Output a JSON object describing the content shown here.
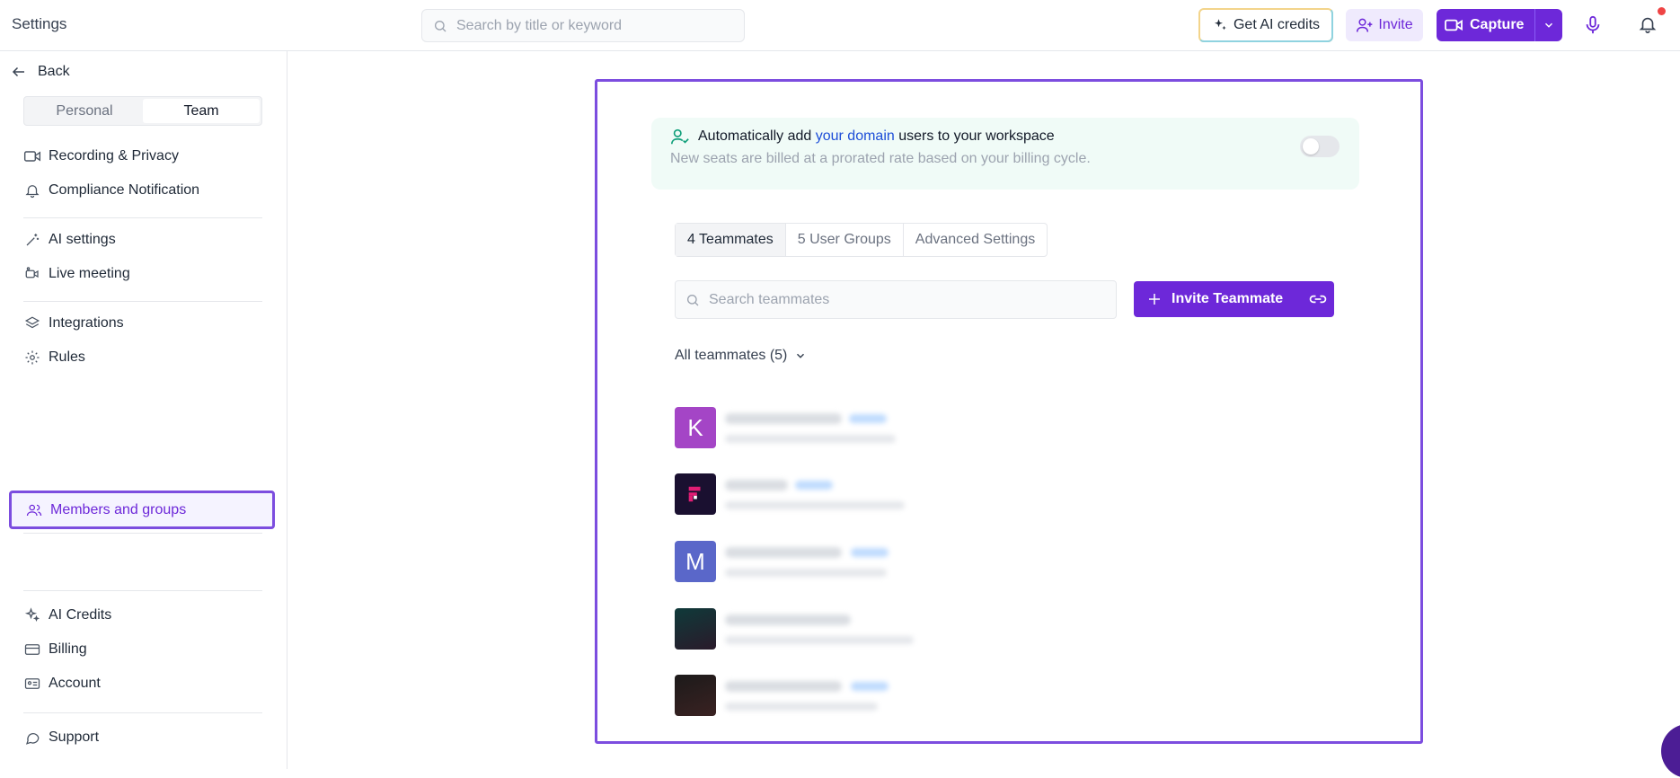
{
  "header": {
    "title": "Settings",
    "search_placeholder": "Search by title or keyword",
    "credits_label": "Get AI credits",
    "invite_label": "Invite",
    "capture_label": "Capture",
    "notification_dot_color": "#ef4444"
  },
  "sidebar": {
    "back_label": "Back",
    "segments": [
      "Personal",
      "Team"
    ],
    "active_segment": "Team",
    "items": [
      {
        "label": "Recording & Privacy",
        "icon": "video-camera-icon"
      },
      {
        "label": "Compliance Notification",
        "icon": "bell-icon"
      },
      {
        "label": "AI settings",
        "icon": "magic-wand-icon"
      },
      {
        "label": "Live meeting",
        "icon": "live-meeting-icon"
      },
      {
        "label": "Integrations",
        "icon": "layers-icon"
      },
      {
        "label": "Rules",
        "icon": "gear-icon"
      },
      {
        "label": "Members and groups",
        "icon": "users-icon"
      },
      {
        "label": "AI Credits",
        "icon": "sparkles-icon"
      },
      {
        "label": "Billing",
        "icon": "credit-card-icon"
      },
      {
        "label": "Account",
        "icon": "id-card-icon"
      },
      {
        "label": "Support",
        "icon": "chat-icon"
      }
    ],
    "active_item": "Members and groups"
  },
  "main": {
    "banner": {
      "text_before": "Automatically add ",
      "link_text": "your domain",
      "text_after": " users to your workspace",
      "subtext": "New seats are billed at a prorated rate based on your billing cycle.",
      "toggle_on": false
    },
    "tabs": [
      {
        "label": "4 Teammates",
        "active": true
      },
      {
        "label": "5 User Groups",
        "active": false
      },
      {
        "label": "Advanced Settings",
        "active": false
      }
    ],
    "search_placeholder": "Search teammates",
    "invite_button_label": "Invite Teammate",
    "filter_label": "All teammates (5)",
    "members": [
      {
        "initial": "K",
        "color": "#a445c6"
      },
      {
        "initial": "",
        "color": "#1a1030"
      },
      {
        "initial": "M",
        "color": "#5a67c9"
      },
      {
        "initial": "",
        "color": "#0f3a3a"
      },
      {
        "initial": "",
        "color": "#1c1a1a"
      }
    ]
  },
  "colors": {
    "accent": "#6d28d9",
    "highlight_border": "#7c4ddf"
  }
}
